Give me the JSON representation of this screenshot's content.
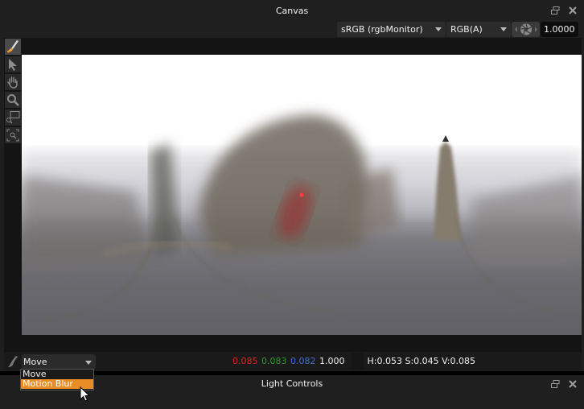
{
  "canvas_panel": {
    "title": "Canvas",
    "toolbar": {
      "colorspace": "sRGB (rgbMonitor)",
      "channel": "RGB(A)",
      "exposure_icon": "aperture-icon",
      "exposure_value": "1.0000"
    },
    "tools": [
      {
        "name": "paint-brush",
        "icon": "brush-icon",
        "active": true
      },
      {
        "name": "select",
        "icon": "arrow-pointer-icon",
        "active": false
      },
      {
        "name": "pan",
        "icon": "hand-icon",
        "active": false
      },
      {
        "name": "zoom",
        "icon": "magnifier-icon",
        "active": false
      },
      {
        "name": "zoom-region",
        "icon": "zoom-rect-icon",
        "active": false
      },
      {
        "name": "zoom-fit",
        "icon": "zoom-fit-icon",
        "active": false
      }
    ],
    "viewport": {
      "content": "blurred equirectangular environment render",
      "marker_color": "#ff3b3b"
    },
    "bottom_bar": {
      "mode_selected": "Move",
      "mode_options": [
        "Move",
        "Motion Blur"
      ],
      "mode_highlighted": "Motion Blur",
      "pixel": {
        "r": "0.085",
        "g": "0.083",
        "b": "0.082",
        "a": "1.000",
        "hsv": "H:0.053 S:0.045 V:0.085"
      }
    }
  },
  "light_panel": {
    "title": "Light Controls"
  },
  "colors": {
    "accent_orange": "#e88d25",
    "red_channel": "#d9231f",
    "green_channel": "#2f9a2f",
    "blue_channel": "#3f6fd0"
  }
}
